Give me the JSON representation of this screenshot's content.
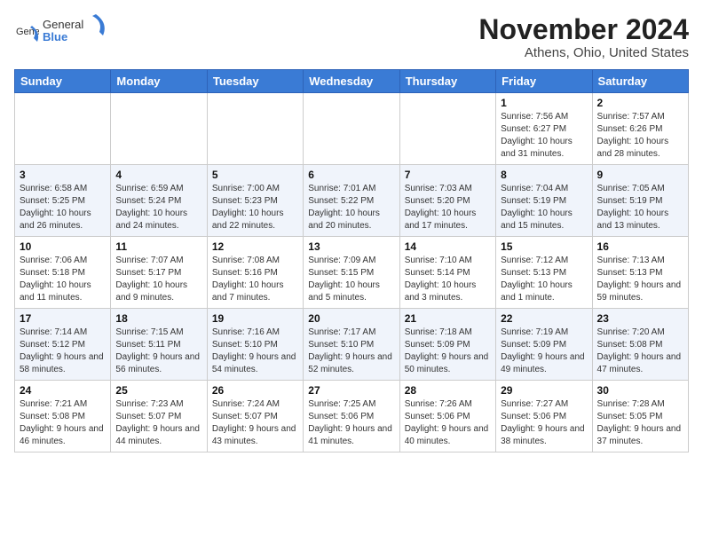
{
  "header": {
    "logo_general": "General",
    "logo_blue": "Blue",
    "month": "November 2024",
    "location": "Athens, Ohio, United States"
  },
  "weekdays": [
    "Sunday",
    "Monday",
    "Tuesday",
    "Wednesday",
    "Thursday",
    "Friday",
    "Saturday"
  ],
  "weeks": [
    [
      {
        "day": "",
        "info": ""
      },
      {
        "day": "",
        "info": ""
      },
      {
        "day": "",
        "info": ""
      },
      {
        "day": "",
        "info": ""
      },
      {
        "day": "",
        "info": ""
      },
      {
        "day": "1",
        "info": "Sunrise: 7:56 AM\nSunset: 6:27 PM\nDaylight: 10 hours and 31 minutes."
      },
      {
        "day": "2",
        "info": "Sunrise: 7:57 AM\nSunset: 6:26 PM\nDaylight: 10 hours and 28 minutes."
      }
    ],
    [
      {
        "day": "3",
        "info": "Sunrise: 6:58 AM\nSunset: 5:25 PM\nDaylight: 10 hours and 26 minutes."
      },
      {
        "day": "4",
        "info": "Sunrise: 6:59 AM\nSunset: 5:24 PM\nDaylight: 10 hours and 24 minutes."
      },
      {
        "day": "5",
        "info": "Sunrise: 7:00 AM\nSunset: 5:23 PM\nDaylight: 10 hours and 22 minutes."
      },
      {
        "day": "6",
        "info": "Sunrise: 7:01 AM\nSunset: 5:22 PM\nDaylight: 10 hours and 20 minutes."
      },
      {
        "day": "7",
        "info": "Sunrise: 7:03 AM\nSunset: 5:20 PM\nDaylight: 10 hours and 17 minutes."
      },
      {
        "day": "8",
        "info": "Sunrise: 7:04 AM\nSunset: 5:19 PM\nDaylight: 10 hours and 15 minutes."
      },
      {
        "day": "9",
        "info": "Sunrise: 7:05 AM\nSunset: 5:19 PM\nDaylight: 10 hours and 13 minutes."
      }
    ],
    [
      {
        "day": "10",
        "info": "Sunrise: 7:06 AM\nSunset: 5:18 PM\nDaylight: 10 hours and 11 minutes."
      },
      {
        "day": "11",
        "info": "Sunrise: 7:07 AM\nSunset: 5:17 PM\nDaylight: 10 hours and 9 minutes."
      },
      {
        "day": "12",
        "info": "Sunrise: 7:08 AM\nSunset: 5:16 PM\nDaylight: 10 hours and 7 minutes."
      },
      {
        "day": "13",
        "info": "Sunrise: 7:09 AM\nSunset: 5:15 PM\nDaylight: 10 hours and 5 minutes."
      },
      {
        "day": "14",
        "info": "Sunrise: 7:10 AM\nSunset: 5:14 PM\nDaylight: 10 hours and 3 minutes."
      },
      {
        "day": "15",
        "info": "Sunrise: 7:12 AM\nSunset: 5:13 PM\nDaylight: 10 hours and 1 minute."
      },
      {
        "day": "16",
        "info": "Sunrise: 7:13 AM\nSunset: 5:13 PM\nDaylight: 9 hours and 59 minutes."
      }
    ],
    [
      {
        "day": "17",
        "info": "Sunrise: 7:14 AM\nSunset: 5:12 PM\nDaylight: 9 hours and 58 minutes."
      },
      {
        "day": "18",
        "info": "Sunrise: 7:15 AM\nSunset: 5:11 PM\nDaylight: 9 hours and 56 minutes."
      },
      {
        "day": "19",
        "info": "Sunrise: 7:16 AM\nSunset: 5:10 PM\nDaylight: 9 hours and 54 minutes."
      },
      {
        "day": "20",
        "info": "Sunrise: 7:17 AM\nSunset: 5:10 PM\nDaylight: 9 hours and 52 minutes."
      },
      {
        "day": "21",
        "info": "Sunrise: 7:18 AM\nSunset: 5:09 PM\nDaylight: 9 hours and 50 minutes."
      },
      {
        "day": "22",
        "info": "Sunrise: 7:19 AM\nSunset: 5:09 PM\nDaylight: 9 hours and 49 minutes."
      },
      {
        "day": "23",
        "info": "Sunrise: 7:20 AM\nSunset: 5:08 PM\nDaylight: 9 hours and 47 minutes."
      }
    ],
    [
      {
        "day": "24",
        "info": "Sunrise: 7:21 AM\nSunset: 5:08 PM\nDaylight: 9 hours and 46 minutes."
      },
      {
        "day": "25",
        "info": "Sunrise: 7:23 AM\nSunset: 5:07 PM\nDaylight: 9 hours and 44 minutes."
      },
      {
        "day": "26",
        "info": "Sunrise: 7:24 AM\nSunset: 5:07 PM\nDaylight: 9 hours and 43 minutes."
      },
      {
        "day": "27",
        "info": "Sunrise: 7:25 AM\nSunset: 5:06 PM\nDaylight: 9 hours and 41 minutes."
      },
      {
        "day": "28",
        "info": "Sunrise: 7:26 AM\nSunset: 5:06 PM\nDaylight: 9 hours and 40 minutes."
      },
      {
        "day": "29",
        "info": "Sunrise: 7:27 AM\nSunset: 5:06 PM\nDaylight: 9 hours and 38 minutes."
      },
      {
        "day": "30",
        "info": "Sunrise: 7:28 AM\nSunset: 5:05 PM\nDaylight: 9 hours and 37 minutes."
      }
    ]
  ]
}
